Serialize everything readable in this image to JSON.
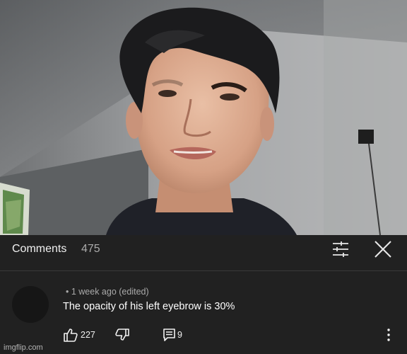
{
  "comments_panel": {
    "title": "Comments",
    "count": "475"
  },
  "comment": {
    "meta": "• 1 week ago (edited)",
    "text": "The opacity of his left eyebrow is 30%",
    "likes": "227",
    "replies": "9"
  },
  "icons": {
    "filter": "sliders-icon",
    "close": "close-icon",
    "like": "thumbs-up-icon",
    "dislike": "thumbs-down-icon",
    "reply": "reply-icon",
    "more": "more-vertical-icon"
  },
  "watermark": "imgflip.com",
  "colors": {
    "panel_bg": "#212121",
    "text_primary": "#ffffff",
    "text_secondary": "#aaaaaa"
  }
}
